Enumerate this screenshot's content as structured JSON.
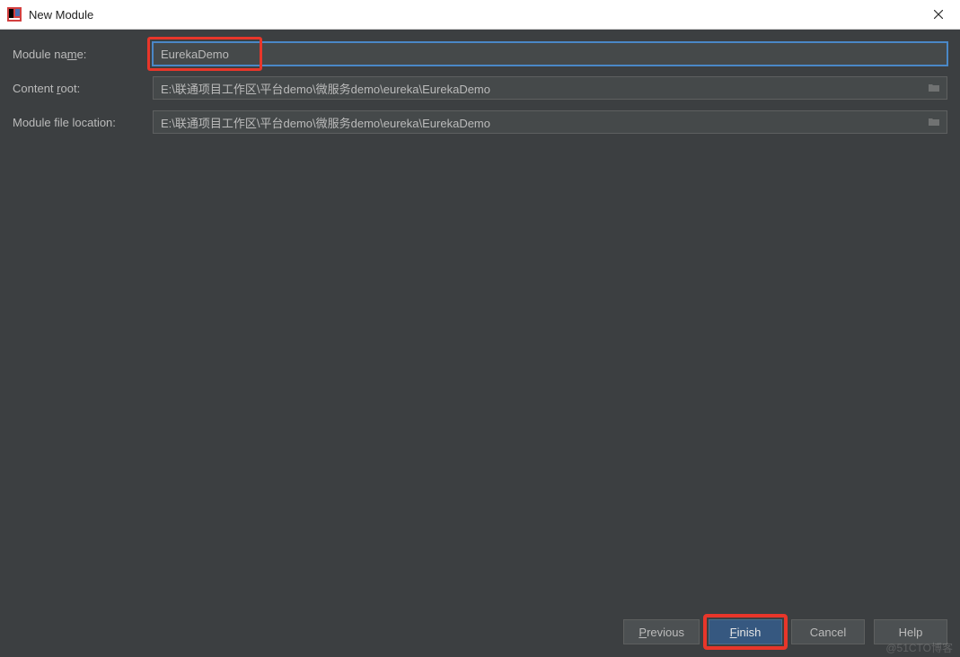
{
  "window": {
    "title": "New Module"
  },
  "form": {
    "module_name": {
      "label_pre": "Module na",
      "label_m": "m",
      "label_post": "e:",
      "value": "EurekaDemo"
    },
    "content_root": {
      "label_pre": "Content ",
      "label_m": "r",
      "label_post": "oot:",
      "value": "E:\\联通项目工作区\\平台demo\\微服务demo\\eureka\\EurekaDemo"
    },
    "module_file_location": {
      "label": "Module file location:",
      "value": "E:\\联通项目工作区\\平台demo\\微服务demo\\eureka\\EurekaDemo"
    }
  },
  "footer": {
    "previous_m": "P",
    "previous_rest": "revious",
    "finish_m": "F",
    "finish_rest": "inish",
    "cancel": "Cancel",
    "help": "Help"
  },
  "watermark": "@51CTO博客"
}
